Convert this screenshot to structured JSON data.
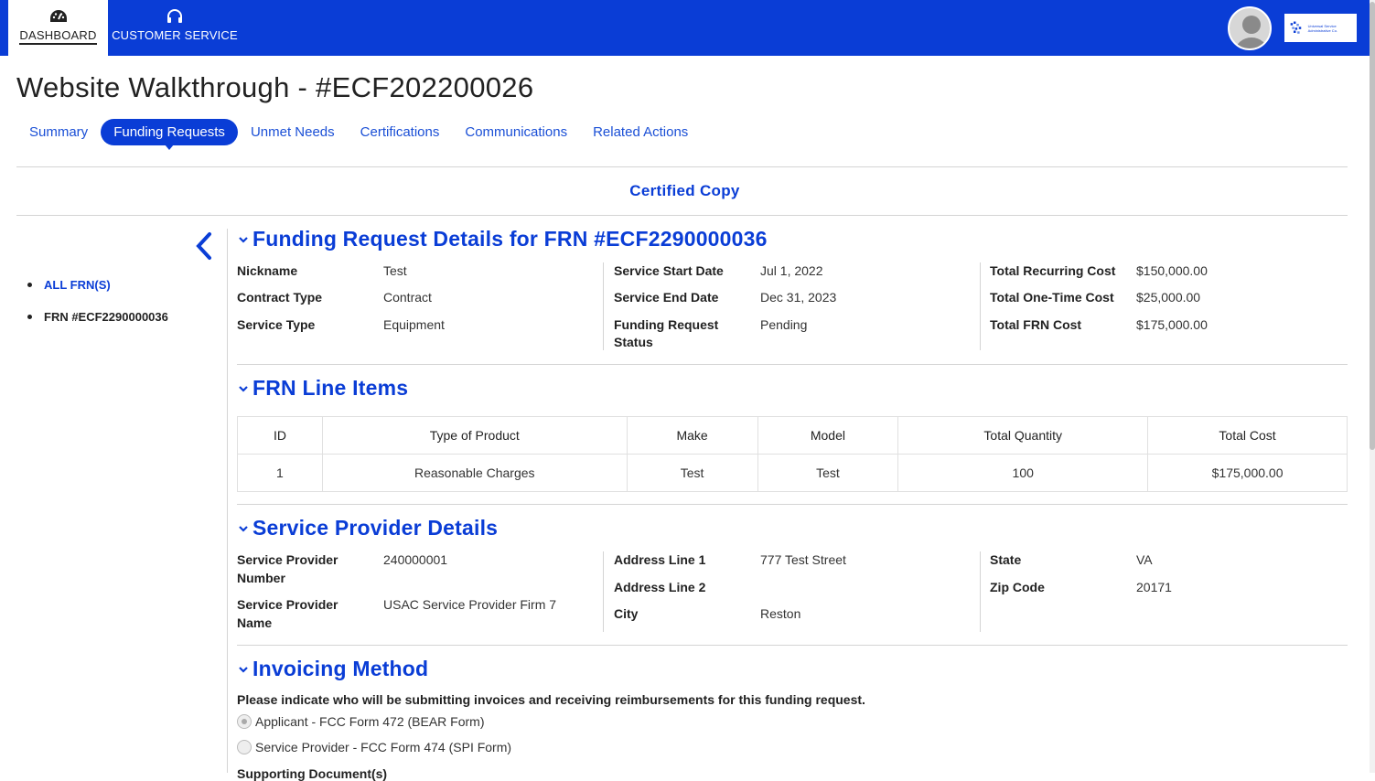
{
  "nav": {
    "dashboard": "DASHBOARD",
    "customer_service": "CUSTOMER SERVICE",
    "logo_text": "Universal Service Administrative Co."
  },
  "page_title": "Website Walkthrough - #ECF202200026",
  "tabs": [
    {
      "label": "Summary",
      "active": false
    },
    {
      "label": "Funding Requests",
      "active": true
    },
    {
      "label": "Unmet Needs",
      "active": false
    },
    {
      "label": "Certifications",
      "active": false
    },
    {
      "label": "Communications",
      "active": false
    },
    {
      "label": "Related Actions",
      "active": false
    }
  ],
  "certified_copy": "Certified Copy",
  "sidebar": {
    "all_frns": "ALL FRN(S)",
    "current_frn": "FRN #ECF2290000036"
  },
  "funding_request": {
    "title": "Funding Request Details for FRN #ECF2290000036",
    "nickname_label": "Nickname",
    "nickname": "Test",
    "contract_type_label": "Contract Type",
    "contract_type": "Contract",
    "service_type_label": "Service Type",
    "service_type": "Equipment",
    "start_label": "Service Start Date",
    "start": "Jul 1, 2022",
    "end_label": "Service End Date",
    "end": "Dec 31, 2023",
    "status_label_1": "Funding Request",
    "status_label_2": "Status",
    "status": "Pending",
    "recurring_label": "Total Recurring Cost",
    "recurring": "$150,000.00",
    "onetime_label": "Total One-Time Cost",
    "onetime": "$25,000.00",
    "total_label": "Total FRN Cost",
    "total": "$175,000.00"
  },
  "line_items": {
    "title": "FRN Line Items",
    "headers": [
      "ID",
      "Type of Product",
      "Make",
      "Model",
      "Total Quantity",
      "Total Cost"
    ],
    "rows": [
      [
        "1",
        "Reasonable Charges",
        "Test",
        "Test",
        "100",
        "$175,000.00"
      ]
    ]
  },
  "service_provider": {
    "title": "Service Provider Details",
    "number_label_1": "Service Provider",
    "number_label_2": "Number",
    "number": "240000001",
    "name_label_1": "Service Provider",
    "name_label_2": "Name",
    "name": "USAC Service Provider Firm 7",
    "addr1_label": "Address Line 1",
    "addr1": "777 Test Street",
    "addr2_label": "Address Line 2",
    "addr2": "",
    "city_label": "City",
    "city": "Reston",
    "state_label": "State",
    "state": "VA",
    "zip_label": "Zip Code",
    "zip": "20171"
  },
  "invoicing": {
    "title": "Invoicing Method",
    "prompt": "Please indicate who will be submitting invoices and receiving reimbursements for this funding request.",
    "option_1": "Applicant - FCC Form 472 (BEAR Form)",
    "option_2": "Service Provider - FCC Form 474 (SPI Form)",
    "option_1_selected": true,
    "cutoff_text": "Supporting Document(s)"
  },
  "colors": {
    "brand_blue": "#0a3dd6",
    "divider": "#d4d4d4"
  }
}
